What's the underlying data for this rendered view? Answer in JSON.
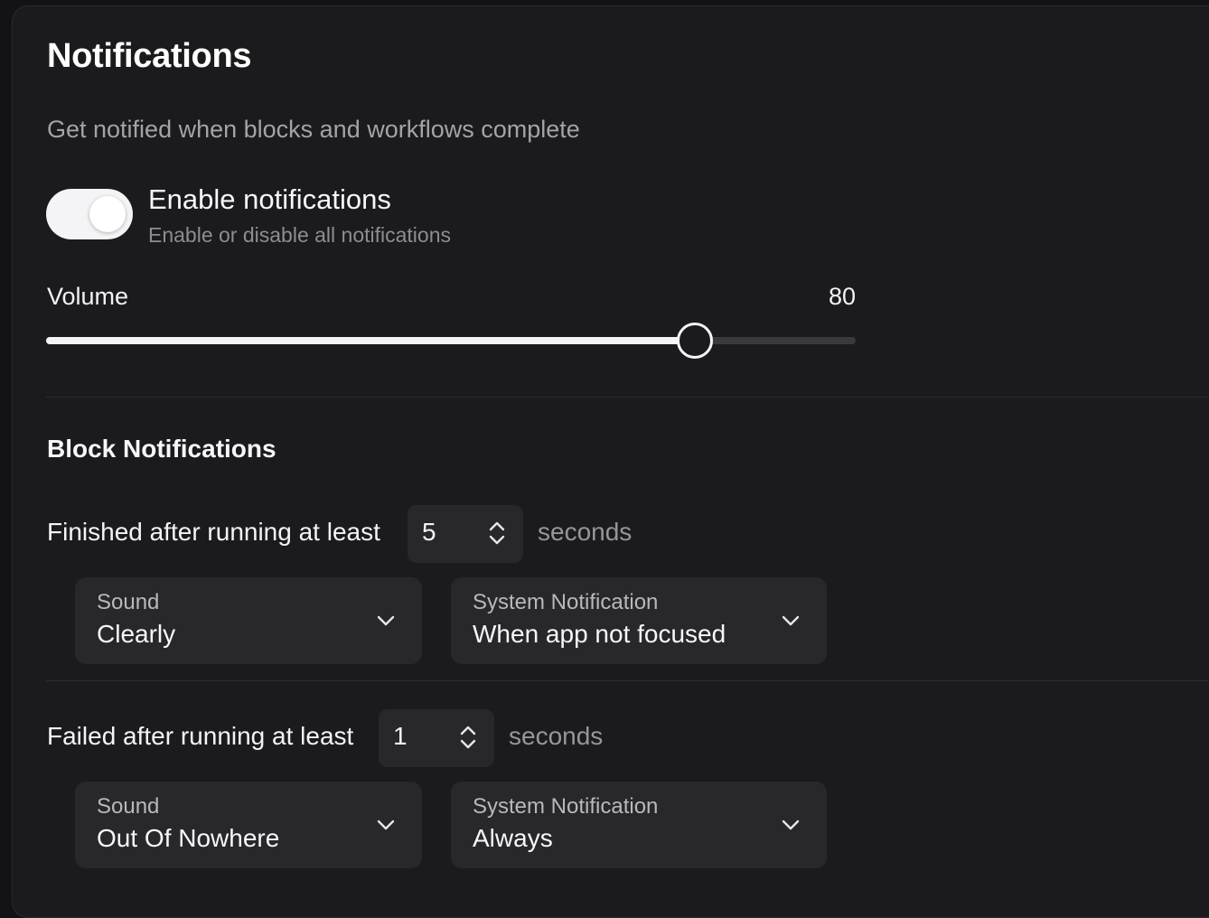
{
  "header": {
    "title": "Notifications",
    "subtitle": "Get notified when blocks and workflows complete"
  },
  "enable": {
    "label": "Enable notifications",
    "description": "Enable or disable all notifications",
    "on": true
  },
  "volume": {
    "label": "Volume",
    "value": "80",
    "percent": 80
  },
  "block_section": {
    "title": "Block Notifications"
  },
  "rules": [
    {
      "label": "Finished after running at least",
      "threshold": "5",
      "unit": "seconds",
      "sound_caption": "Sound",
      "sound_value": "Clearly",
      "system_caption": "System Notification",
      "system_value": "When app not focused"
    },
    {
      "label": "Failed after running at least",
      "threshold": "1",
      "unit": "seconds",
      "sound_caption": "Sound",
      "sound_value": "Out Of Nowhere",
      "system_caption": "System Notification",
      "system_value": "Always"
    }
  ],
  "colors": {
    "background": "#1b1b1d",
    "control": "#28282b",
    "accent": "#f5f5f7"
  },
  "icons": {
    "stepper": "up-down-chevron-icon",
    "dropdown": "chevron-down-icon"
  }
}
